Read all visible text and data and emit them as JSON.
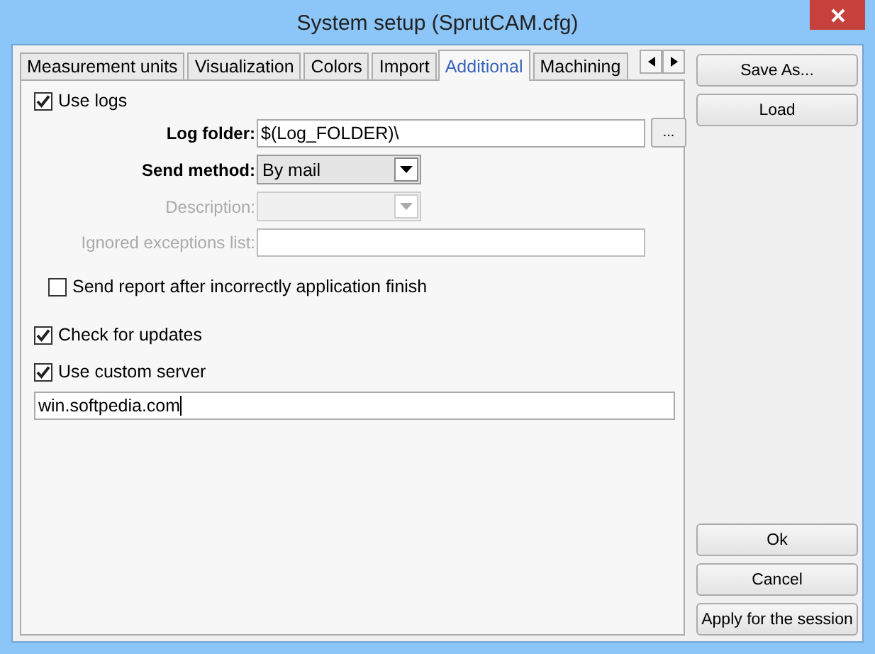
{
  "window": {
    "title": "System setup (SprutCAM.cfg)"
  },
  "tabs": [
    {
      "label": "Measurement units",
      "selected": false
    },
    {
      "label": "Visualization",
      "selected": false
    },
    {
      "label": "Colors",
      "selected": false
    },
    {
      "label": "Import",
      "selected": false
    },
    {
      "label": "Additional",
      "selected": true
    },
    {
      "label": "Machining",
      "selected": false
    }
  ],
  "use_logs": {
    "label": "Use logs",
    "checked": true
  },
  "log_fields": [
    {
      "label": "Log folder:",
      "kind": "text",
      "value": "$(Log_FOLDER)\\",
      "browse": "...",
      "disabled": false
    },
    {
      "label": "Send method:",
      "kind": "select",
      "value": "By mail",
      "disabled": false
    },
    {
      "label": "Description:",
      "kind": "select",
      "disabled": true
    },
    {
      "label": "Ignored exceptions list:",
      "kind": "text",
      "disabled": true
    }
  ],
  "send_report": {
    "label": "Send report after incorrectly application finish",
    "checked": false
  },
  "check_updates": {
    "label": "Check for updates",
    "checked": true
  },
  "use_custom_server": {
    "label": "Use custom server",
    "checked": true
  },
  "server": {
    "value": "win.softpedia.com"
  },
  "top_buttons": [
    "Save As...",
    "Load"
  ],
  "bottom_buttons": [
    "Ok",
    "Cancel",
    "Apply for the session"
  ]
}
